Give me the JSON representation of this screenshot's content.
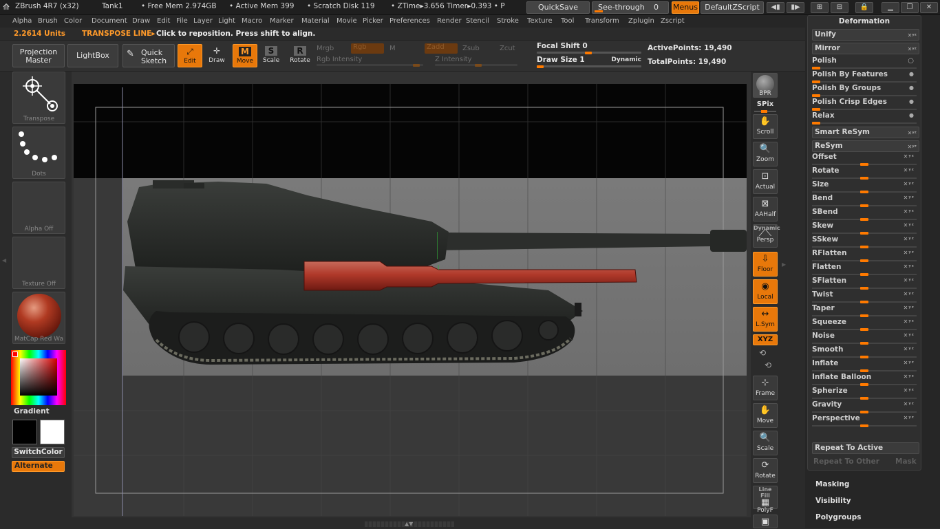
{
  "titlebar": {
    "app": "ZBrush 4R7 (x32)",
    "doc": "Tank1",
    "free_mem": "• Free Mem 2.974GB",
    "active_mem": "• Active Mem 399",
    "scratch": "• Scratch Disk 119",
    "ztime": "• ZTime▸3.656 Timer▸0.393 • P",
    "quicksave": "QuickSave",
    "seethrough_label": "See-through",
    "seethrough_value": "0",
    "menus": "Menus",
    "default_zscript": "DefaultZScript"
  },
  "menu": [
    "Alpha",
    "Brush",
    "Color",
    "Document",
    "Draw",
    "Edit",
    "File",
    "Layer",
    "Light",
    "Macro",
    "Marker",
    "Material",
    "Movie",
    "Picker",
    "Preferences",
    "Render",
    "Stencil",
    "Stroke",
    "Texture",
    "Tool",
    "Transform",
    "Zplugin",
    "Zscript"
  ],
  "status": {
    "units": "2.2614 Units",
    "mode": "TRANSPOSE LINE▸",
    "hint": "Click to reposition. Press shift to align."
  },
  "toolbar": {
    "projection_master": "Projection Master",
    "lightbox": "LightBox",
    "quick_sketch": "Quick Sketch",
    "edit": "Edit",
    "draw": "Draw",
    "move": "Move",
    "scale": "Scale",
    "rotate": "Rotate",
    "mrgb": "Mrgb",
    "rgb": "Rgb",
    "m": "M",
    "zadd": "Zadd",
    "zsub": "Zsub",
    "zcut": "Zcut",
    "rgb_intensity": "Rgb Intensity",
    "z_intensity": "Z Intensity",
    "focal_shift": "Focal Shift 0",
    "draw_size": "Draw Size 1",
    "dynamic": "Dynamic",
    "active_points": "ActivePoints: 19,490",
    "total_points": "TotalPoints: 19,490"
  },
  "leftshelf": {
    "transpose": "Transpose",
    "dots": "Dots",
    "alpha_off": "Alpha Off",
    "texture_off": "Texture Off",
    "matcap": "MatCap Red Wa",
    "gradient": "Gradient",
    "switchcolor": "SwitchColor",
    "alternate": "Alternate"
  },
  "rightshelf": {
    "bpr": "BPR",
    "spix": "SPix",
    "scroll": "Scroll",
    "zoom": "Zoom",
    "actual": "Actual",
    "aahalf": "AAHalf",
    "dynamic": "Dynamic",
    "persp": "Persp",
    "floor": "Floor",
    "local": "Local",
    "lsym": "L.Sym",
    "xyz": "XYZ",
    "frame": "Frame",
    "move": "Move",
    "scale": "Scale",
    "rotate": "Rotate",
    "line_fill": "Line Fill",
    "polyf": "PolyF"
  },
  "deformation": {
    "title": "Deformation",
    "unify": "Unify",
    "mirror": "Mirror",
    "polish": "Polish",
    "polish_features": "Polish By Features",
    "polish_groups": "Polish By Groups",
    "polish_crisp": "Polish Crisp Edges",
    "relax": "Relax",
    "smart_resym": "Smart ReSym",
    "resym": "ReSym",
    "sliders": [
      "Offset",
      "Rotate",
      "Size",
      "Bend",
      "SBend",
      "Skew",
      "SSkew",
      "RFlatten",
      "Flatten",
      "SFlatten",
      "Twist",
      "Taper",
      "Squeeze",
      "Noise",
      "Smooth",
      "Inflate",
      "Inflate Balloon",
      "Spherize",
      "Gravity",
      "Perspective"
    ],
    "repeat_active": "Repeat To Active",
    "repeat_other": "Repeat To Other",
    "mask": "Mask"
  },
  "subpanels": {
    "masking": "Masking",
    "visibility": "Visibility",
    "polygroups": "Polygroups"
  },
  "colors": {
    "accent": "#e8780a",
    "selection": "#b0392a"
  }
}
